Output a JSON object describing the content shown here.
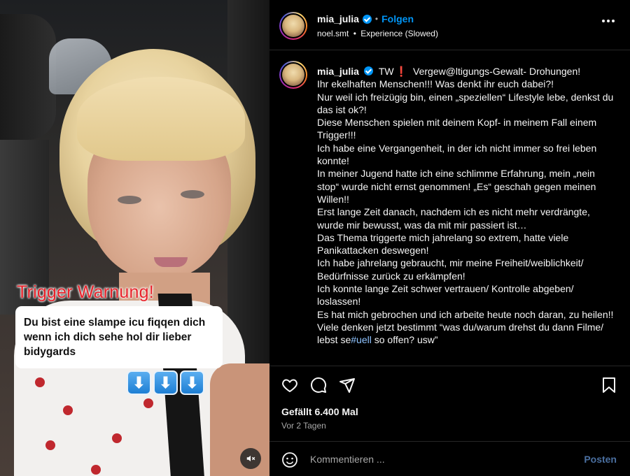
{
  "media": {
    "trigger_title": "Trigger Warnung!",
    "quote": "Du bist eine slampe icu fiqqen dich wenn ich dich sehe hol dir lieber bidygards",
    "arrow_glyph": "⬇",
    "mute_icon": "speaker-muted-icon"
  },
  "header": {
    "username": "mia_julia",
    "separator": "•",
    "follow_label": "Folgen",
    "audio_author": "noel.smt",
    "audio_title": "Experience (Slowed)"
  },
  "caption": {
    "username": "mia_julia",
    "tw": "TW",
    "excl": "❗",
    "lines": [
      "Vergew@ltigungs-Gewalt- Drohungen!",
      "Ihr ekelhaften Menschen!!! Was denkt ihr euch dabei?!",
      "Nur weil ich freizügig bin, einen „speziellen“ Lifestyle lebe, denkst du das ist ok?!",
      "Diese Menschen spielen mit deinem Kopf- in meinem Fall einem Trigger!!!",
      "Ich habe eine Vergangenheit, in der ich nicht immer so frei leben konnte!",
      "In meiner Jugend hatte ich eine schlimme Erfahrung, mein „nein stop“ wurde nicht ernst genommen! „Es“ geschah gegen meinen Willen!!",
      "Erst lange Zeit danach, nachdem ich es nicht mehr verdrängte, wurde mir bewusst, was da mit mir passiert ist…",
      "Das Thema triggerte mich jahrelang so extrem, hatte viele Panikattacken deswegen!",
      "Ich habe jahrelang gebraucht, mir meine Freiheit/weiblichkeit/ Bedürfnisse zurück zu erkämpfen!",
      "Ich konnte lange Zeit schwer vertrauen/ Kontrolle abgeben/ loslassen!",
      "Es hat mich gebrochen und ich arbeite heute noch daran, zu heilen!!"
    ],
    "last_line_prefix": "Viele denken jetzt bestimmt “was du/warum drehst du dann Filme/ lebst se",
    "hashtag": "#uell",
    "last_line_suffix": " so offen? usw”"
  },
  "actions": {
    "likes": "Gefällt 6.400 Mal",
    "time_ago": "Vor 2 Tagen"
  },
  "comment": {
    "placeholder": "Kommentieren ...",
    "post_label": "Posten"
  }
}
